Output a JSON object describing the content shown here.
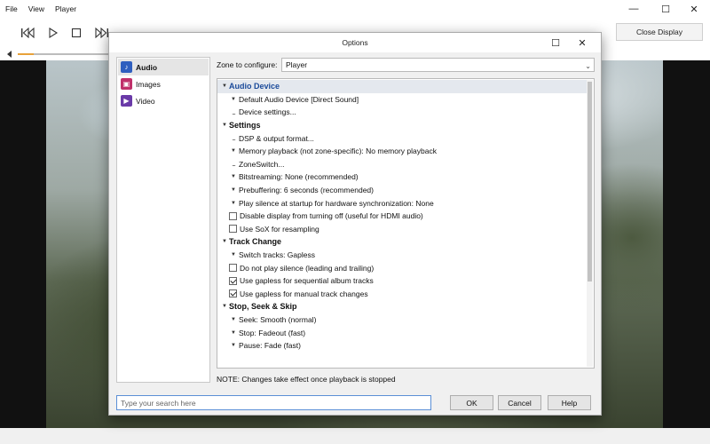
{
  "menu": [
    "File",
    "View",
    "Player"
  ],
  "window_controls": {
    "minimize": "—",
    "maximize": "☐",
    "close": "✕"
  },
  "toolbar": {
    "close_display": "Close Display"
  },
  "seek": {
    "progress": 0.17
  },
  "dialog": {
    "title": "Options",
    "controls": {
      "maximize": "☐",
      "close": "✕"
    },
    "categories": [
      {
        "label": "Audio",
        "color": "#2f5fbf",
        "icon": "music-note-icon"
      },
      {
        "label": "Images",
        "color": "#c0306a",
        "icon": "image-icon"
      },
      {
        "label": "Video",
        "color": "#6a3aa8",
        "icon": "video-icon"
      }
    ],
    "zone_label": "Zone to configure:",
    "zone_value": "Player",
    "note": "NOTE: Changes take effect once playback is stopped",
    "search_placeholder": "Type your search here",
    "buttons": {
      "ok": "OK",
      "cancel": "Cancel",
      "help": "Help"
    }
  },
  "tree": [
    {
      "type": "header",
      "text": "Audio Device",
      "active": true
    },
    {
      "type": "option",
      "marker": "bullet",
      "text": "Default Audio Device [Direct Sound]"
    },
    {
      "type": "option",
      "marker": "dots",
      "text": "Device settings..."
    },
    {
      "type": "header",
      "text": "Settings"
    },
    {
      "type": "option",
      "marker": "dots",
      "text": "DSP & output format..."
    },
    {
      "type": "option",
      "marker": "bullet",
      "text": "Memory playback (not zone-specific): No memory playback"
    },
    {
      "type": "option",
      "marker": "dots",
      "text": "ZoneSwitch..."
    },
    {
      "type": "option",
      "marker": "bullet",
      "text": "Bitstreaming: None (recommended)"
    },
    {
      "type": "option",
      "marker": "bullet",
      "text": "Prebuffering: 6 seconds (recommended)"
    },
    {
      "type": "option",
      "marker": "bullet",
      "text": "Play silence at startup for hardware synchronization: None"
    },
    {
      "type": "option",
      "marker": "checkbox",
      "checked": false,
      "text": "Disable display from turning off (useful for HDMI audio)"
    },
    {
      "type": "option",
      "marker": "checkbox",
      "checked": false,
      "text": "Use SoX for resampling"
    },
    {
      "type": "header",
      "text": "Track Change"
    },
    {
      "type": "option",
      "marker": "bullet",
      "text": "Switch tracks: Gapless"
    },
    {
      "type": "option",
      "marker": "checkbox",
      "checked": false,
      "text": "Do not play silence (leading and trailing)"
    },
    {
      "type": "option",
      "marker": "checkbox",
      "checked": true,
      "text": "Use gapless for sequential album tracks"
    },
    {
      "type": "option",
      "marker": "checkbox",
      "checked": true,
      "text": "Use gapless for manual track changes"
    },
    {
      "type": "header",
      "text": "Stop, Seek & Skip"
    },
    {
      "type": "option",
      "marker": "bullet",
      "text": "Seek: Smooth (normal)"
    },
    {
      "type": "option",
      "marker": "bullet",
      "text": "Stop: Fadeout (fast)"
    },
    {
      "type": "option",
      "marker": "bullet",
      "text": "Pause: Fade (fast)"
    }
  ]
}
